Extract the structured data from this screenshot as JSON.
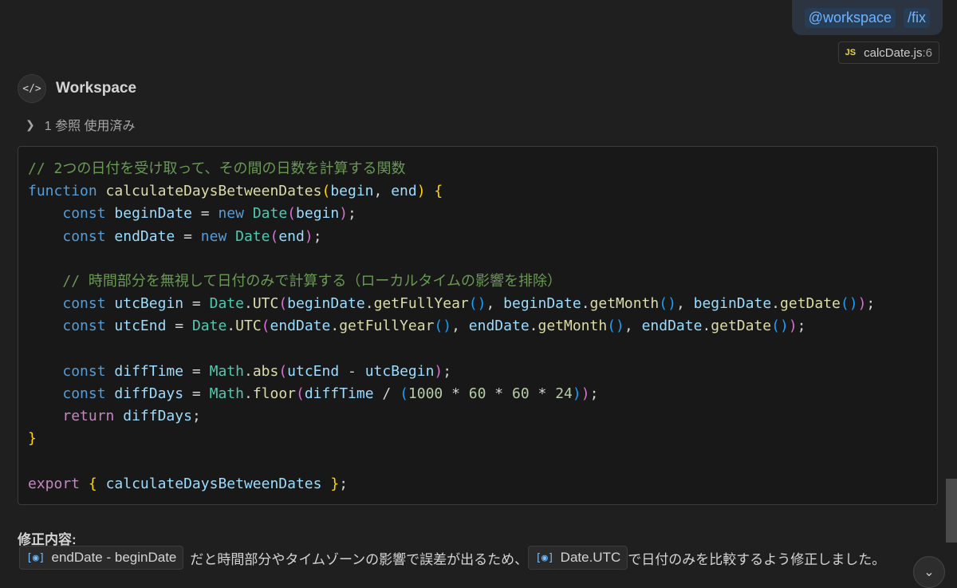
{
  "request": {
    "agent": "@workspace",
    "command": "/fix"
  },
  "file_ref": {
    "badge": "JS",
    "name": "calcDate.js",
    "line": ":6"
  },
  "workspace": {
    "avatar_glyph": "</>",
    "name": "Workspace"
  },
  "references": {
    "label": "1 参照 使用済み"
  },
  "code": {
    "l1": "// 2つの日付を受け取って、その間の日数を計算する関数",
    "l6": "// 時間部分を無視して日付のみで計算する（ローカルタイムの影響を排除）"
  },
  "summary": {
    "title": "修正内容:",
    "chip1": "endDate - beginDate",
    "text1": "だと時間部分やタイムゾーンの影響で誤差が出るため、",
    "chip2": "Date.UTC",
    "text2": "で日付のみを比較するよう修正しました。"
  },
  "icons": {
    "symbol": "[◉]",
    "scroll_down": "chevron-down"
  }
}
